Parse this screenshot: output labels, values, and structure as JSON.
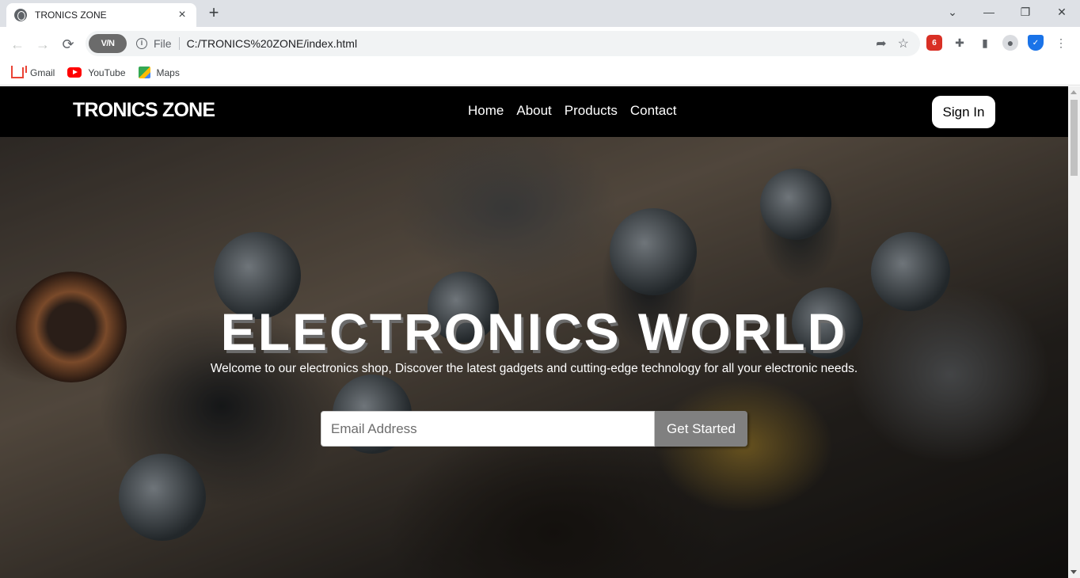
{
  "browser": {
    "tab_title": "TRONICS ZONE",
    "url_scheme_label": "File",
    "url": "C:/TRONICS%20ZONE/index.html",
    "vpn_label": "V/N",
    "bookmarks": [
      {
        "label": "Gmail",
        "icon": "gmail-icon"
      },
      {
        "label": "YouTube",
        "icon": "youtube-icon"
      },
      {
        "label": "Maps",
        "icon": "maps-icon"
      }
    ]
  },
  "site": {
    "logo": "TRONICS ZONE",
    "nav": [
      "Home",
      "About",
      "Products",
      "Contact"
    ],
    "signin_label": "Sign In"
  },
  "hero": {
    "heading": "ELECTRONICS WORLD",
    "subtitle": "Welcome to our electronics shop, Discover the latest gadgets and cutting-edge technology for all your electronic needs.",
    "email_placeholder": "Email Address",
    "cta_label": "Get Started"
  },
  "colors": {
    "nav_bg": "#000000",
    "cta_bg": "#808080",
    "chrome_bg": "#dee1e6"
  }
}
